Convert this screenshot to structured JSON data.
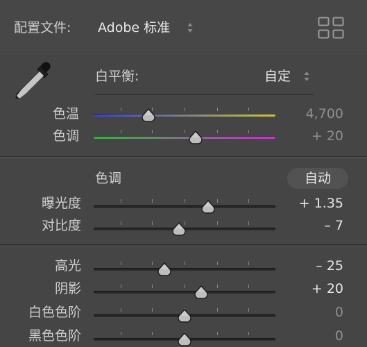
{
  "profile": {
    "label": "配置文件:",
    "value": "Adobe 标准"
  },
  "icons": {
    "grid": "grid-view-icon",
    "eyedropper": "eyedropper-icon",
    "updown": "up-down-arrows-icon"
  },
  "white_balance": {
    "label": "白平衡:",
    "value": "自定",
    "temp": {
      "label": "色温",
      "value": "4,700",
      "level": 0.3
    },
    "tint": {
      "label": "色调",
      "value": "+ 20",
      "level": 0.56
    }
  },
  "tone": {
    "title": "色调",
    "auto_label": "自动",
    "sliders": [
      {
        "key": "exposure",
        "label": "曝光度",
        "value": "+ 1.35",
        "level": 0.63,
        "dim": false
      },
      {
        "key": "contrast",
        "label": "对比度",
        "value": "– 7",
        "level": 0.47,
        "dim": false
      }
    ]
  },
  "presence": {
    "sliders": [
      {
        "key": "highlights",
        "label": "高光",
        "value": "– 25",
        "level": 0.39,
        "dim": false
      },
      {
        "key": "shadows",
        "label": "阴影",
        "value": "+ 20",
        "level": 0.59,
        "dim": false
      },
      {
        "key": "whites",
        "label": "白色色阶",
        "value": "0",
        "level": 0.5,
        "dim": true
      },
      {
        "key": "blacks",
        "label": "黑色色阶",
        "value": "0",
        "level": 0.5,
        "dim": true
      }
    ]
  },
  "colors": {
    "temp_start": "#3a46c4",
    "temp_end": "#c9c24a",
    "tint_start": "#43b14a",
    "tint_end": "#c23cc8"
  }
}
